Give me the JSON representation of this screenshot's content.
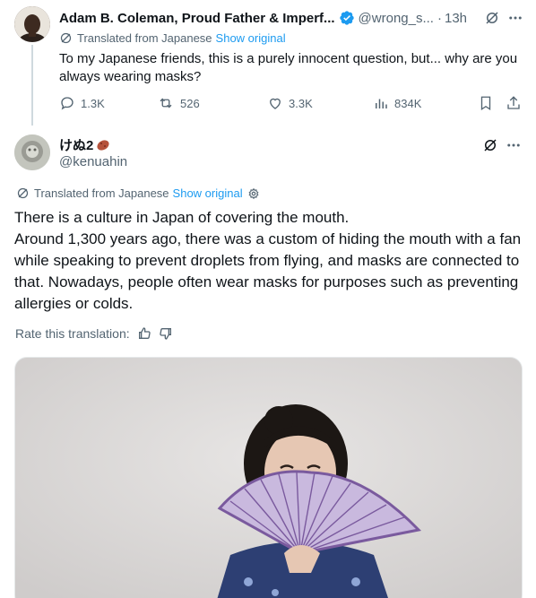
{
  "parent_tweet": {
    "author_name": "Adam B. Coleman, Proud Father & Imperf...",
    "handle": "@wrong_s...",
    "separator": "·",
    "time": "13h",
    "translated_label": "Translated from Japanese",
    "show_original": "Show original",
    "text": "To my Japanese friends, this is a purely innocent question, but... why are you always wearing masks?",
    "stats": {
      "replies": "1.3K",
      "reposts": "526",
      "likes": "3.3K",
      "views": "834K"
    }
  },
  "reply_tweet": {
    "author_name": "けぬ2",
    "handle": "@kenuahin",
    "translated_label": "Translated from Japanese",
    "show_original": "Show original",
    "text_lines": [
      "There is a culture in Japan of covering the mouth.",
      "Around 1,300 years ago, there was a custom of hiding the mouth with a fan while speaking to prevent droplets from flying, and masks are connected to that. Nowadays, people often wear masks for purposes such as preventing allergies or colds."
    ],
    "rate_label": "Rate this translation:"
  },
  "icons": {
    "verified": "verified-badge-icon",
    "grok": "grok-icon",
    "more": "more-icon",
    "globe": "globe-icon",
    "reply": "reply-icon",
    "repost": "repost-icon",
    "like": "heart-icon",
    "views": "views-icon",
    "bookmark": "bookmark-icon",
    "share": "share-icon",
    "settings": "gear-icon",
    "thumbs_up": "thumbs-up-icon",
    "thumbs_down": "thumbs-down-icon"
  },
  "colors": {
    "accent": "#1d9bf0",
    "text_primary": "#0f1419",
    "text_secondary": "#536471",
    "fan_purple": "#7a5a9e"
  }
}
